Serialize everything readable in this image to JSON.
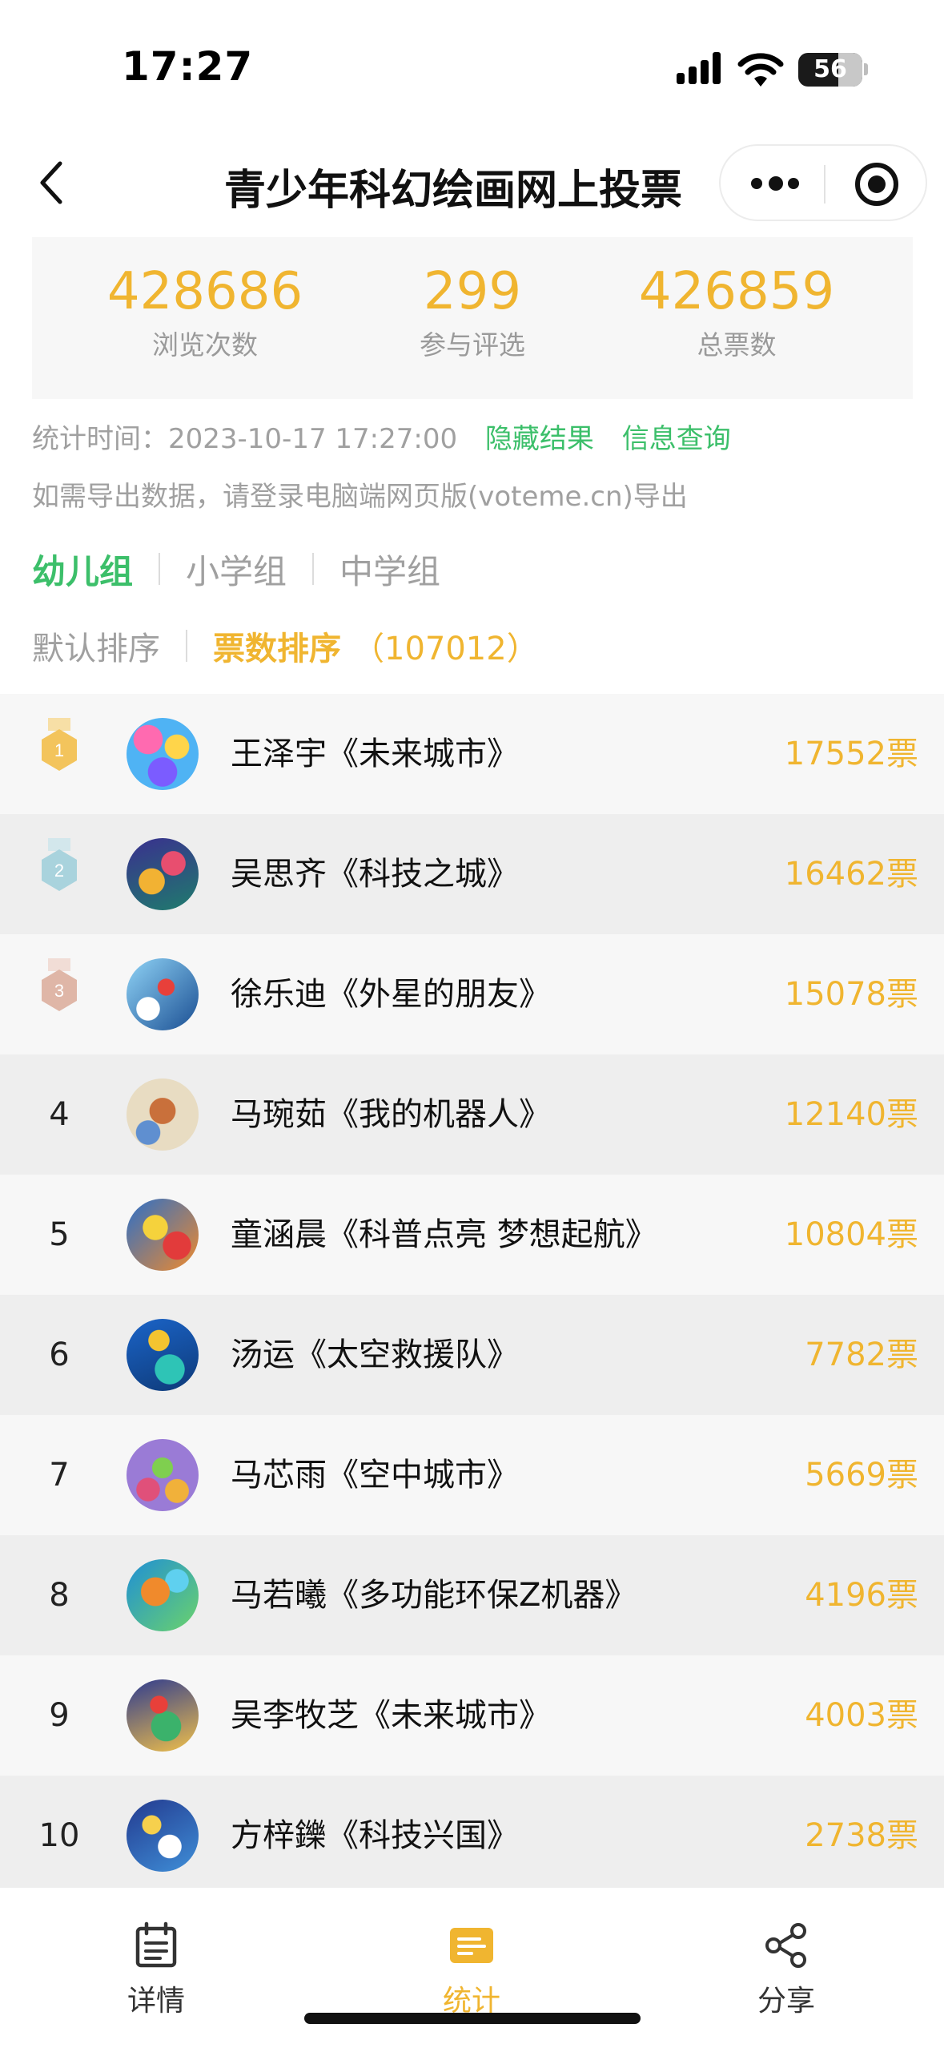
{
  "status_bar": {
    "time": "17:27",
    "battery": "56"
  },
  "nav": {
    "title": "青少年科幻绘画网上投票"
  },
  "stats": [
    {
      "value": "428686",
      "label": "浏览次数"
    },
    {
      "value": "299",
      "label": "参与评选"
    },
    {
      "value": "426859",
      "label": "总票数"
    }
  ],
  "stat_time": {
    "label": "统计时间：",
    "value": "2023-10-17 17:27:00",
    "hide_link": "隐藏结果",
    "query_link": "信息查询"
  },
  "export_note": "如需导出数据，请登录电脑端网页版(voteme.cn)导出",
  "groups": [
    "幼儿组",
    "小学组",
    "中学组"
  ],
  "sort": {
    "default": "默认排序",
    "by_votes": "票数排序",
    "count": "（107012）"
  },
  "entries": [
    {
      "rank": "1",
      "name": "王泽宇《未来城市》",
      "votes": "17552票"
    },
    {
      "rank": "2",
      "name": "吴思齐《科技之城》",
      "votes": "16462票"
    },
    {
      "rank": "3",
      "name": "徐乐迪《外星的朋友》",
      "votes": "15078票"
    },
    {
      "rank": "4",
      "name": "马琬茹《我的机器人》",
      "votes": "12140票"
    },
    {
      "rank": "5",
      "name": "童涵晨《科普点亮 梦想起航》",
      "votes": "10804票"
    },
    {
      "rank": "6",
      "name": "汤运《太空救援队》",
      "votes": "7782票"
    },
    {
      "rank": "7",
      "name": "马芯雨《空中城市》",
      "votes": "5669票"
    },
    {
      "rank": "8",
      "name": "马若曦《多功能环保Z机器》",
      "votes": "4196票"
    },
    {
      "rank": "9",
      "name": "吴李牧芝《未来城市》",
      "votes": "4003票"
    },
    {
      "rank": "10",
      "name": "方梓鑠《科技兴国》",
      "votes": "2738票"
    }
  ],
  "tabbar": [
    {
      "label": "详情",
      "icon": "calendar-icon"
    },
    {
      "label": "统计",
      "icon": "stats-icon"
    },
    {
      "label": "分享",
      "icon": "share-icon"
    }
  ],
  "colors": {
    "accent_yellow": "#f0b530",
    "accent_green": "#3cbf6a"
  }
}
